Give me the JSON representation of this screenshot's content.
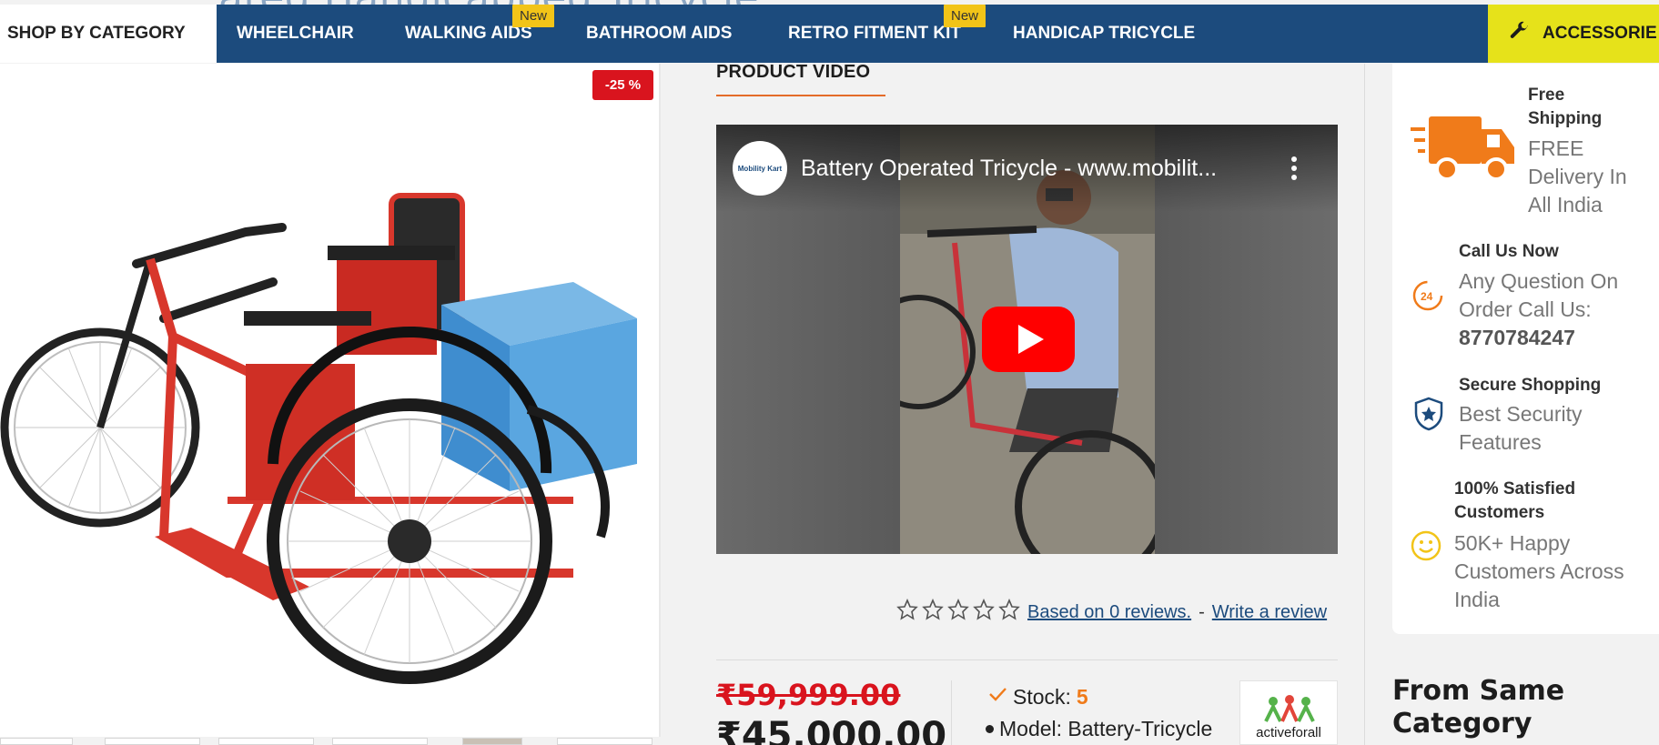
{
  "page": {
    "ghost_title": "ated Handicapped Tricycle"
  },
  "nav": {
    "shop_by_category": "SHOP BY CATEGORY",
    "items": [
      {
        "label": "WHEELCHAIR",
        "badge": ""
      },
      {
        "label": "WALKING AIDS",
        "badge": "New"
      },
      {
        "label": "BATHROOM AIDS",
        "badge": ""
      },
      {
        "label": "RETRO FITMENT KIT",
        "badge": "New"
      },
      {
        "label": "HANDICAP TRICYCLE",
        "badge": ""
      }
    ],
    "accessories": "ACCESSORIE",
    "accessories_icon": "wrench-icon"
  },
  "product": {
    "discount": "-25 %",
    "old_price": "₹59,999.00",
    "new_price": "₹45,000.00",
    "stock_label": "Stock:",
    "stock_value": "5",
    "model_label": "Model: Battery-Tricycle",
    "brand_logo": "activeforall"
  },
  "video_section": {
    "title": "PRODUCT VIDEO",
    "video_title": "Battery Operated Tricycle - www.mobilit...",
    "channel_logo": "Mobility Kart"
  },
  "reviews": {
    "stars_filled": 0,
    "stars_total": 5,
    "based_on": "Based on 0 reviews.",
    "separator": "-",
    "write_review": "Write a review"
  },
  "sidebar": {
    "features": [
      {
        "title": "Free Shipping",
        "text": "FREE Delivery In All India",
        "icon": "truck-icon"
      },
      {
        "title": "Call Us Now",
        "text": "Any Question On Order Call Us:",
        "phone": "8770784247",
        "icon": "phone-24-icon"
      },
      {
        "title": "Secure Shopping",
        "text": "Best Security Features",
        "icon": "shield-star-icon"
      },
      {
        "title": "100% Satisfied Customers",
        "text": "50K+ Happy Customers Across India",
        "icon": "smiley-icon"
      }
    ],
    "from_same_category": "From Same Category"
  },
  "colors": {
    "nav_blue": "#1c4b7d",
    "accent_yellow": "#e6e21a",
    "badge_yellow": "#f2c418",
    "sale_red": "#d9141e",
    "stock_orange": "#f07b1a",
    "icon_orange": "#f07b1a",
    "icon_navy": "#1c4b7d",
    "icon_yellow": "#f2c418"
  }
}
